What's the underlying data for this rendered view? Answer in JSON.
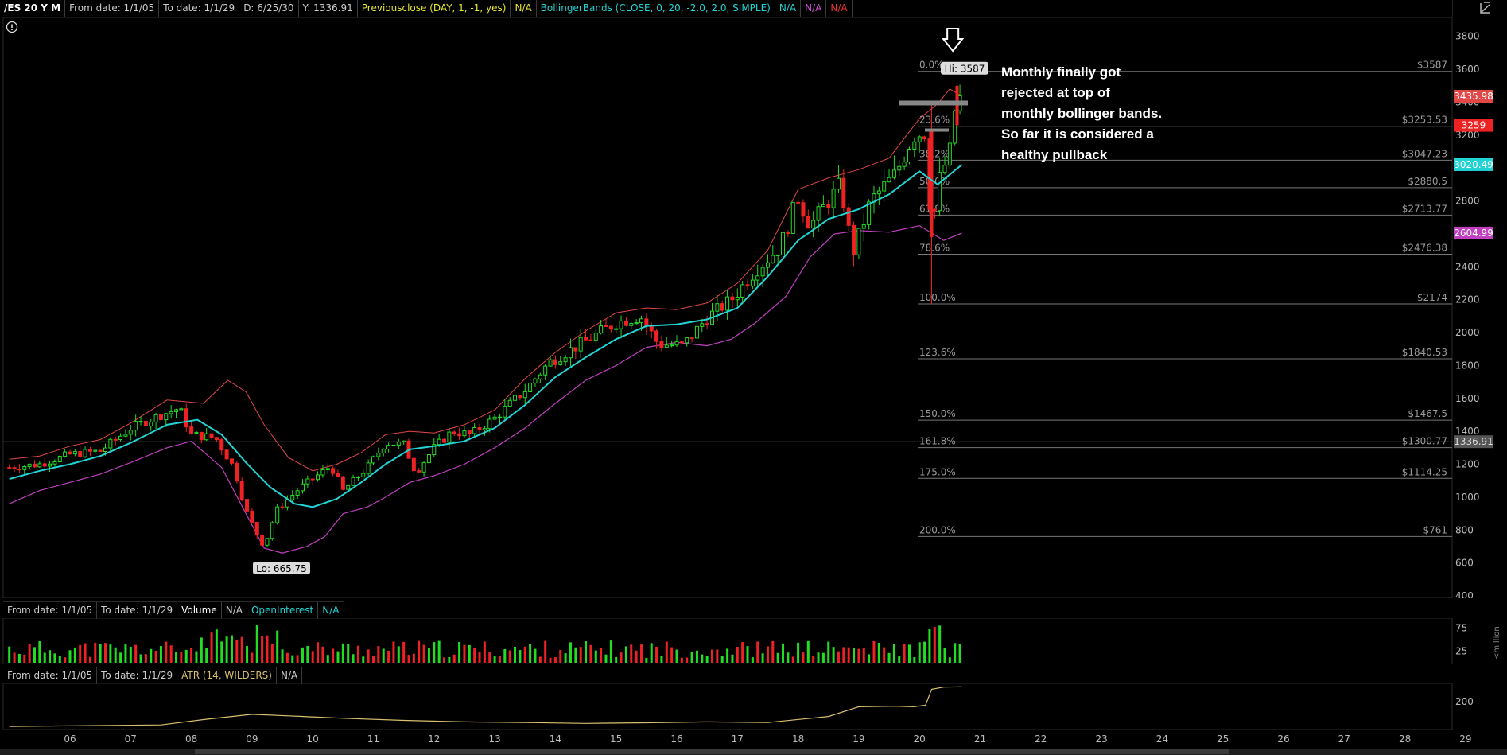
{
  "header": {
    "symbol": "/ES 20 Y M",
    "from": "From date: 1/1/05",
    "to": "To date: 1/1/29",
    "d": "D: 6/25/30",
    "y": "Y: 1336.91",
    "prevclose": "Previousclose (DAY, 1, -1, yes)",
    "prevclose_val": "N/A",
    "bb": "BollingerBands (CLOSE, 0, 20, -2.0, 2.0, SIMPLE)",
    "bb_v1": "N/A",
    "bb_v2": "N/A",
    "bb_v3": "N/A"
  },
  "volume_header": {
    "from": "From date: 1/1/05",
    "to": "To date: 1/1/29",
    "vol": "Volume",
    "vol_val": "N/A",
    "oi": "OpenInterest",
    "oi_val": "N/A"
  },
  "atr_header": {
    "from": "From date: 1/1/05",
    "to": "To date: 1/1/29",
    "atr": "ATR (14, WILDERS)",
    "atr_val": "N/A"
  },
  "annotation": {
    "lines": [
      "Monthly finally got",
      "rejected at top of",
      "monthly bollinger bands.",
      "So far it is considered a",
      "healthy pullback"
    ]
  },
  "colors": {
    "up": "#22dd22",
    "down": "#ee2222",
    "mid": "#22d3d3",
    "upper": "#e04848",
    "lower": "#c040c0",
    "atr": "#d8c070",
    "fib": "#777777",
    "prevclose": "#e6e633",
    "bbcolor": "#22d3d3",
    "na_red": "#ee3333",
    "na_pink": "#d050d0"
  },
  "chart_data": {
    "type": "candlestick",
    "x_ticks": [
      "06",
      "07",
      "08",
      "09",
      "10",
      "11",
      "12",
      "13",
      "14",
      "15",
      "16",
      "17",
      "18",
      "19",
      "20",
      "21",
      "22",
      "23",
      "24",
      "25",
      "26",
      "27",
      "28",
      "29"
    ],
    "y_ticks": [
      400,
      600,
      800,
      1000,
      1200,
      1400,
      1600,
      1800,
      2000,
      2200,
      2400,
      2600,
      2800,
      3000,
      3200,
      3400,
      3600,
      3800
    ],
    "ylim": [
      400,
      3900
    ],
    "price_labels": [
      {
        "text": "3435.98",
        "value": 3435.98,
        "color": "#e04848"
      },
      {
        "text": "3259",
        "value": 3259,
        "color": "#ee2222"
      },
      {
        "text": "3020.49",
        "value": 3020.49,
        "color": "#22d3d3"
      },
      {
        "text": "2604.99",
        "value": 2604.99,
        "color": "#c040c0"
      },
      {
        "text": "1336.91",
        "value": 1336.91,
        "color": "#555555"
      }
    ],
    "hi_label": "Hi: 3587",
    "lo_label": "Lo: 665.75",
    "fib_levels": [
      {
        "pct": "0.0%",
        "price": "$3587",
        "value": 3587
      },
      {
        "pct": "23.6%",
        "price": "$3253.53",
        "value": 3253.53
      },
      {
        "pct": "38.2%",
        "price": "$3047.23",
        "value": 3047.23
      },
      {
        "pct": "50.0%",
        "price": "$2880.5",
        "value": 2880.5
      },
      {
        "pct": "61.8%",
        "price": "$2713.77",
        "value": 2713.77
      },
      {
        "pct": "78.6%",
        "price": "$2476.38",
        "value": 2476.38
      },
      {
        "pct": "100.0%",
        "price": "$2174",
        "value": 2174
      },
      {
        "pct": "123.6%",
        "price": "$1840.53",
        "value": 1840.53
      },
      {
        "pct": "150.0%",
        "price": "$1467.5",
        "value": 1467.5
      },
      {
        "pct": "161.8%",
        "price": "$1300.77",
        "value": 1300.77
      },
      {
        "pct": "175.0%",
        "price": "$1114.25",
        "value": 1114.25
      },
      {
        "pct": "200.0%",
        "price": "$761",
        "value": 761
      }
    ],
    "prev_close": 1336.91,
    "monthly_close_path": [
      [
        2005.0,
        1180
      ],
      [
        2005.5,
        1200
      ],
      [
        2006.0,
        1260
      ],
      [
        2006.5,
        1280
      ],
      [
        2007.0,
        1420
      ],
      [
        2007.5,
        1500
      ],
      [
        2007.8,
        1540
      ],
      [
        2008.0,
        1380
      ],
      [
        2008.4,
        1360
      ],
      [
        2008.7,
        1180
      ],
      [
        2008.9,
        920
      ],
      [
        2009.1,
        760
      ],
      [
        2009.2,
        700
      ],
      [
        2009.4,
        920
      ],
      [
        2009.8,
        1060
      ],
      [
        2010.0,
        1110
      ],
      [
        2010.3,
        1190
      ],
      [
        2010.5,
        1040
      ],
      [
        2010.9,
        1180
      ],
      [
        2011.2,
        1330
      ],
      [
        2011.5,
        1320
      ],
      [
        2011.7,
        1150
      ],
      [
        2012.0,
        1300
      ],
      [
        2012.3,
        1400
      ],
      [
        2012.6,
        1380
      ],
      [
        2013.0,
        1480
      ],
      [
        2013.5,
        1650
      ],
      [
        2013.9,
        1820
      ],
      [
        2014.5,
        1950
      ],
      [
        2015.0,
        2060
      ],
      [
        2015.4,
        2100
      ],
      [
        2015.7,
        1930
      ],
      [
        2016.1,
        1920
      ],
      [
        2016.5,
        2090
      ],
      [
        2016.9,
        2200
      ],
      [
        2017.3,
        2380
      ],
      [
        2017.7,
        2520
      ],
      [
        2018.0,
        2820
      ],
      [
        2018.2,
        2650
      ],
      [
        2018.7,
        2900
      ],
      [
        2018.9,
        2480
      ],
      [
        2019.2,
        2800
      ],
      [
        2019.6,
        2960
      ],
      [
        2019.9,
        3200
      ],
      [
        2020.1,
        3220
      ],
      [
        2020.2,
        2580
      ],
      [
        2020.3,
        2900
      ],
      [
        2020.5,
        3100
      ],
      [
        2020.6,
        3400
      ],
      [
        2020.65,
        3500
      ],
      [
        2020.7,
        3259
      ]
    ],
    "upper_band": [
      [
        2005.0,
        1230
      ],
      [
        2005.5,
        1250
      ],
      [
        2006.0,
        1310
      ],
      [
        2006.5,
        1350
      ],
      [
        2007.0,
        1450
      ],
      [
        2007.6,
        1590
      ],
      [
        2008.2,
        1570
      ],
      [
        2008.6,
        1710
      ],
      [
        2008.9,
        1640
      ],
      [
        2009.2,
        1440
      ],
      [
        2009.6,
        1240
      ],
      [
        2010.0,
        1160
      ],
      [
        2010.4,
        1200
      ],
      [
        2010.8,
        1270
      ],
      [
        2011.2,
        1380
      ],
      [
        2011.6,
        1400
      ],
      [
        2012.0,
        1390
      ],
      [
        2012.5,
        1440
      ],
      [
        2013.0,
        1530
      ],
      [
        2013.5,
        1720
      ],
      [
        2014.0,
        1880
      ],
      [
        2014.5,
        2010
      ],
      [
        2015.0,
        2120
      ],
      [
        2015.5,
        2150
      ],
      [
        2016.0,
        2140
      ],
      [
        2016.5,
        2180
      ],
      [
        2017.0,
        2300
      ],
      [
        2017.5,
        2500
      ],
      [
        2018.0,
        2870
      ],
      [
        2018.5,
        2940
      ],
      [
        2019.0,
        2990
      ],
      [
        2019.5,
        3060
      ],
      [
        2020.0,
        3300
      ],
      [
        2020.3,
        3390
      ],
      [
        2020.5,
        3480
      ],
      [
        2020.7,
        3436
      ]
    ],
    "middle_band": [
      [
        2005.0,
        1110
      ],
      [
        2005.5,
        1160
      ],
      [
        2006.0,
        1200
      ],
      [
        2006.5,
        1250
      ],
      [
        2007.0,
        1330
      ],
      [
        2007.6,
        1440
      ],
      [
        2008.1,
        1470
      ],
      [
        2008.5,
        1380
      ],
      [
        2008.9,
        1210
      ],
      [
        2009.3,
        1060
      ],
      [
        2009.7,
        960
      ],
      [
        2010.0,
        940
      ],
      [
        2010.4,
        990
      ],
      [
        2010.8,
        1090
      ],
      [
        2011.2,
        1200
      ],
      [
        2011.6,
        1290
      ],
      [
        2012.0,
        1310
      ],
      [
        2012.5,
        1340
      ],
      [
        2013.0,
        1420
      ],
      [
        2013.5,
        1560
      ],
      [
        2014.0,
        1730
      ],
      [
        2014.5,
        1850
      ],
      [
        2015.0,
        1960
      ],
      [
        2015.5,
        2040
      ],
      [
        2016.0,
        2050
      ],
      [
        2016.5,
        2080
      ],
      [
        2017.0,
        2150
      ],
      [
        2017.5,
        2340
      ],
      [
        2018.0,
        2560
      ],
      [
        2018.5,
        2690
      ],
      [
        2019.0,
        2750
      ],
      [
        2019.5,
        2840
      ],
      [
        2020.0,
        2980
      ],
      [
        2020.3,
        2900
      ],
      [
        2020.5,
        2960
      ],
      [
        2020.7,
        3020
      ]
    ],
    "lower_band": [
      [
        2005.0,
        960
      ],
      [
        2005.5,
        1040
      ],
      [
        2006.0,
        1090
      ],
      [
        2006.5,
        1140
      ],
      [
        2007.0,
        1210
      ],
      [
        2007.6,
        1300
      ],
      [
        2008.0,
        1340
      ],
      [
        2008.5,
        1180
      ],
      [
        2008.9,
        900
      ],
      [
        2009.2,
        690
      ],
      [
        2009.5,
        660
      ],
      [
        2009.9,
        700
      ],
      [
        2010.2,
        760
      ],
      [
        2010.5,
        900
      ],
      [
        2010.9,
        940
      ],
      [
        2011.2,
        1000
      ],
      [
        2011.6,
        1090
      ],
      [
        2012.0,
        1130
      ],
      [
        2012.5,
        1200
      ],
      [
        2013.0,
        1300
      ],
      [
        2013.5,
        1420
      ],
      [
        2014.0,
        1570
      ],
      [
        2014.5,
        1710
      ],
      [
        2015.0,
        1800
      ],
      [
        2015.5,
        1910
      ],
      [
        2016.0,
        1940
      ],
      [
        2016.5,
        1920
      ],
      [
        2016.9,
        1960
      ],
      [
        2017.3,
        2060
      ],
      [
        2017.8,
        2220
      ],
      [
        2018.2,
        2460
      ],
      [
        2018.6,
        2600
      ],
      [
        2019.0,
        2620
      ],
      [
        2019.5,
        2610
      ],
      [
        2020.0,
        2650
      ],
      [
        2020.4,
        2560
      ],
      [
        2020.7,
        2605
      ]
    ],
    "volume_ylabels": [
      25,
      75
    ],
    "volume_unit": "<million",
    "atr_ylabels": [
      200
    ],
    "atr_path": [
      [
        2005.0,
        0.05
      ],
      [
        2007.5,
        0.1
      ],
      [
        2008.3,
        0.3
      ],
      [
        2009.0,
        0.45
      ],
      [
        2009.6,
        0.4
      ],
      [
        2010.5,
        0.32
      ],
      [
        2011.5,
        0.25
      ],
      [
        2012.5,
        0.2
      ],
      [
        2013.5,
        0.18
      ],
      [
        2014.5,
        0.15
      ],
      [
        2015.5,
        0.17
      ],
      [
        2016.5,
        0.2
      ],
      [
        2017.5,
        0.18
      ],
      [
        2018.5,
        0.38
      ],
      [
        2019.0,
        0.7
      ],
      [
        2019.6,
        0.72
      ],
      [
        2019.9,
        0.7
      ],
      [
        2020.1,
        0.75
      ],
      [
        2020.2,
        1.28
      ],
      [
        2020.4,
        1.35
      ],
      [
        2020.7,
        1.36
      ]
    ]
  }
}
